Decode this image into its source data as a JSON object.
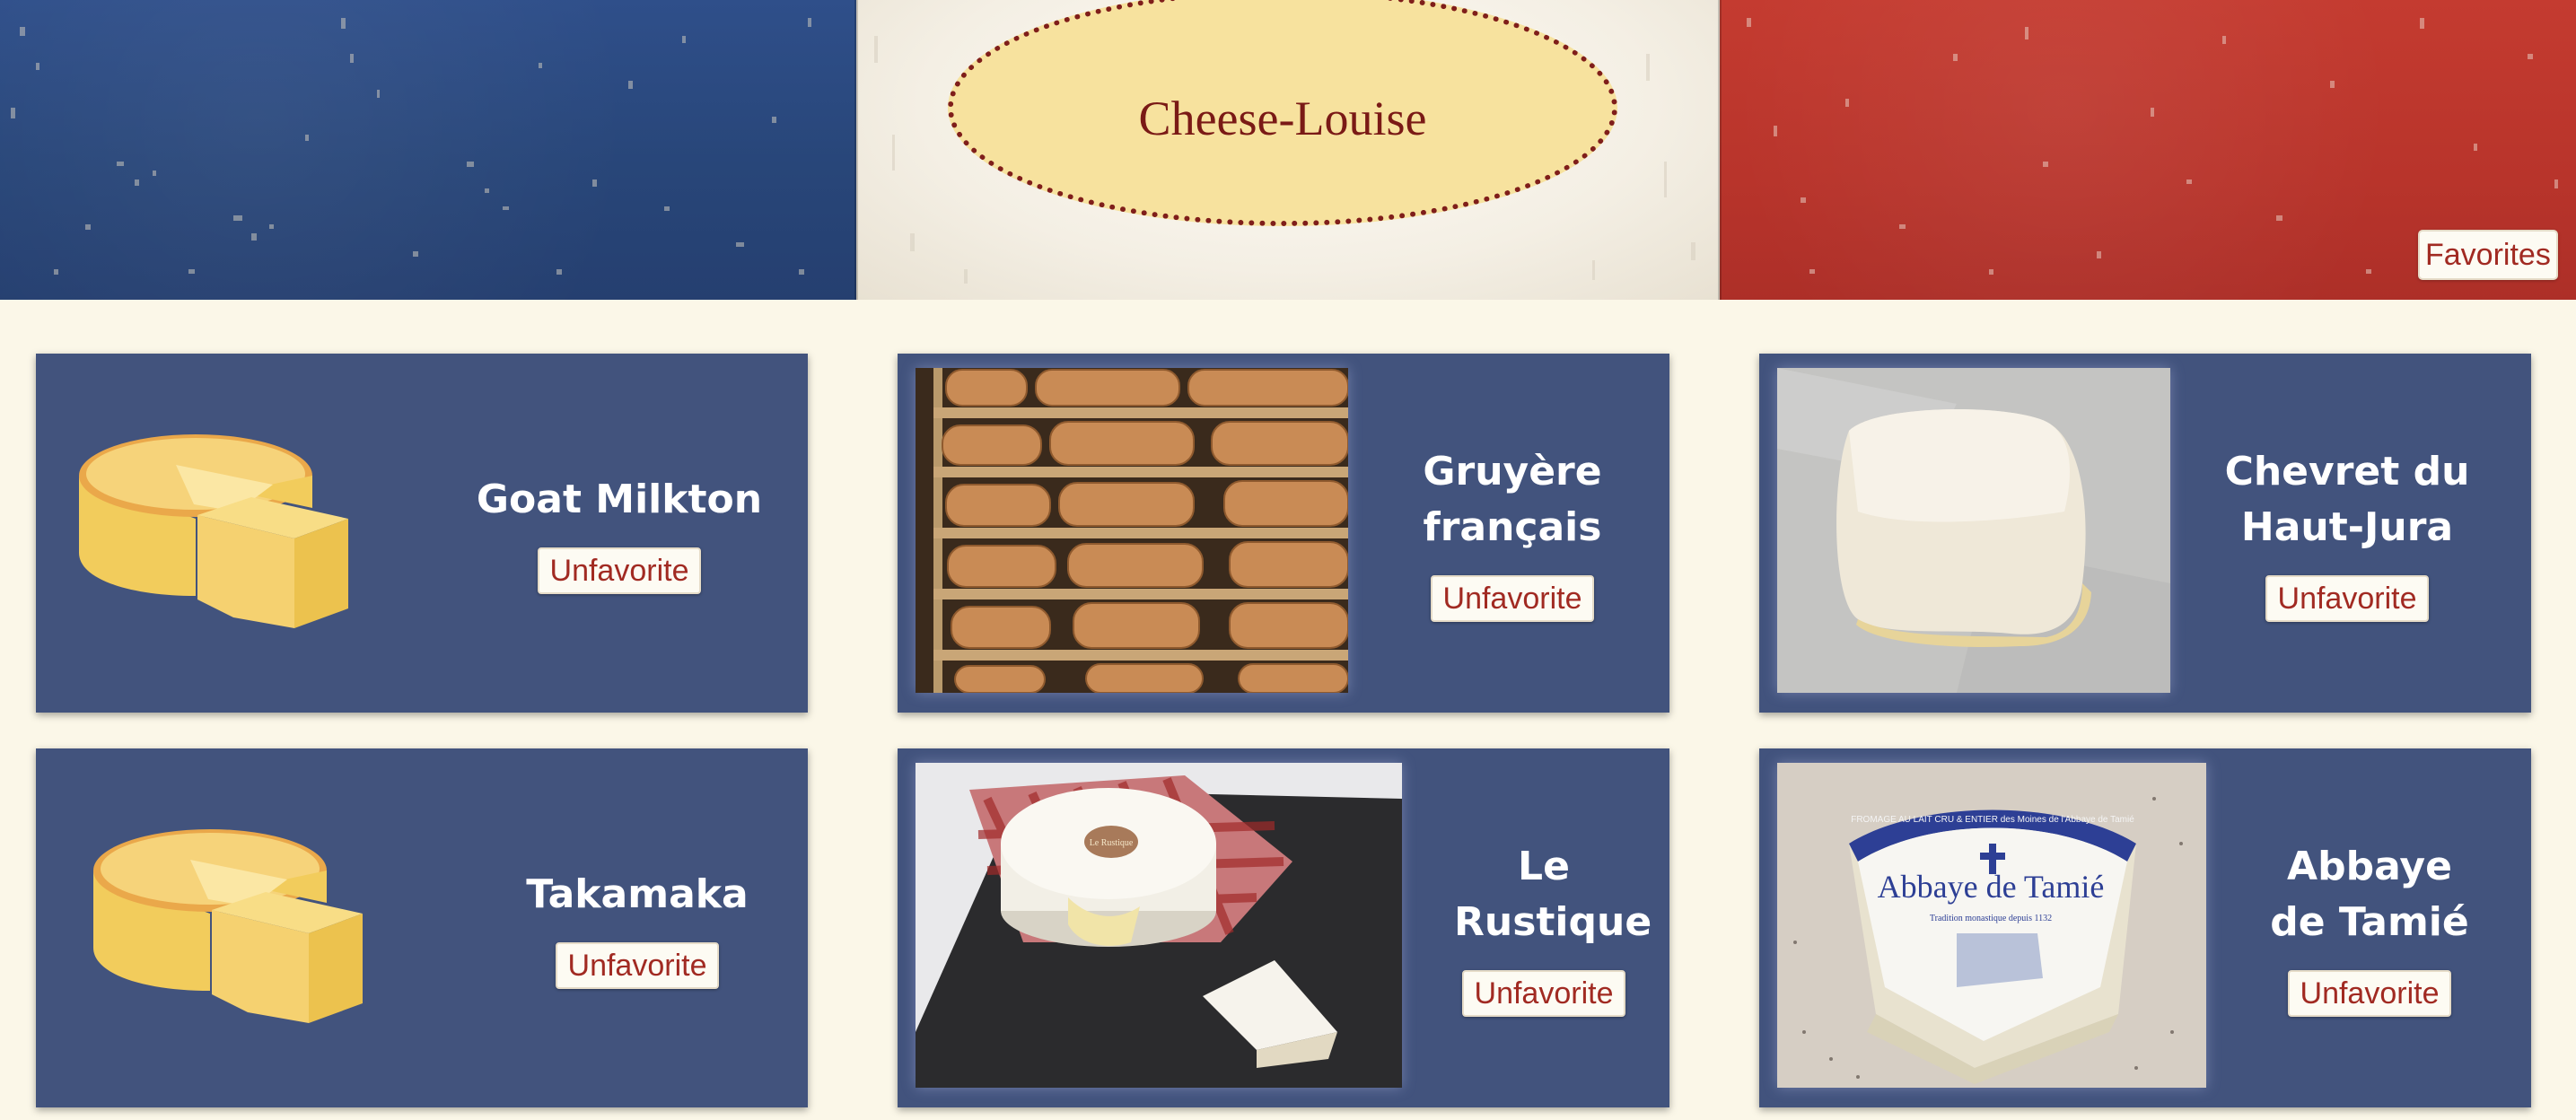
{
  "header": {
    "logo_text": "Cheese-Louise",
    "favorites_label": "Favorites"
  },
  "colors": {
    "flag_blue": "#2b4a82",
    "flag_white": "#f4efe4",
    "flag_red": "#be382e",
    "card_bg": "#42537d",
    "button_text": "#a12a22",
    "logo_fill": "#f7e29e",
    "logo_border": "#7f1e1a",
    "page_bg": "#fbf7e8"
  },
  "cards": [
    {
      "name": "Goat Milkton",
      "button": "Unfavorite",
      "image": "cheese-wheel-icon"
    },
    {
      "name": "Gruyère français",
      "button": "Unfavorite",
      "image": "gruyere-photo"
    },
    {
      "name": "Chevret du Haut-Jura",
      "button": "Unfavorite",
      "image": "chevret-photo"
    },
    {
      "name": "Takamaka",
      "button": "Unfavorite",
      "image": "cheese-wheel-icon"
    },
    {
      "name": "Le Rustique",
      "button": "Unfavorite",
      "image": "camembert-photo"
    },
    {
      "name": "Abbaye de Tamié",
      "button": "Unfavorite",
      "image": "tamie-photo"
    }
  ],
  "labels": {
    "tamie_label_title": "Abbaye de Tamié",
    "tamie_label_top": "FROMAGE AU LAIT CRU & ENTIER des Moines de l'Abbaye de Tamié",
    "tamie_label_sub": "Tradition monastique depuis 1132",
    "rustique_stamp": "Le Rustique"
  }
}
